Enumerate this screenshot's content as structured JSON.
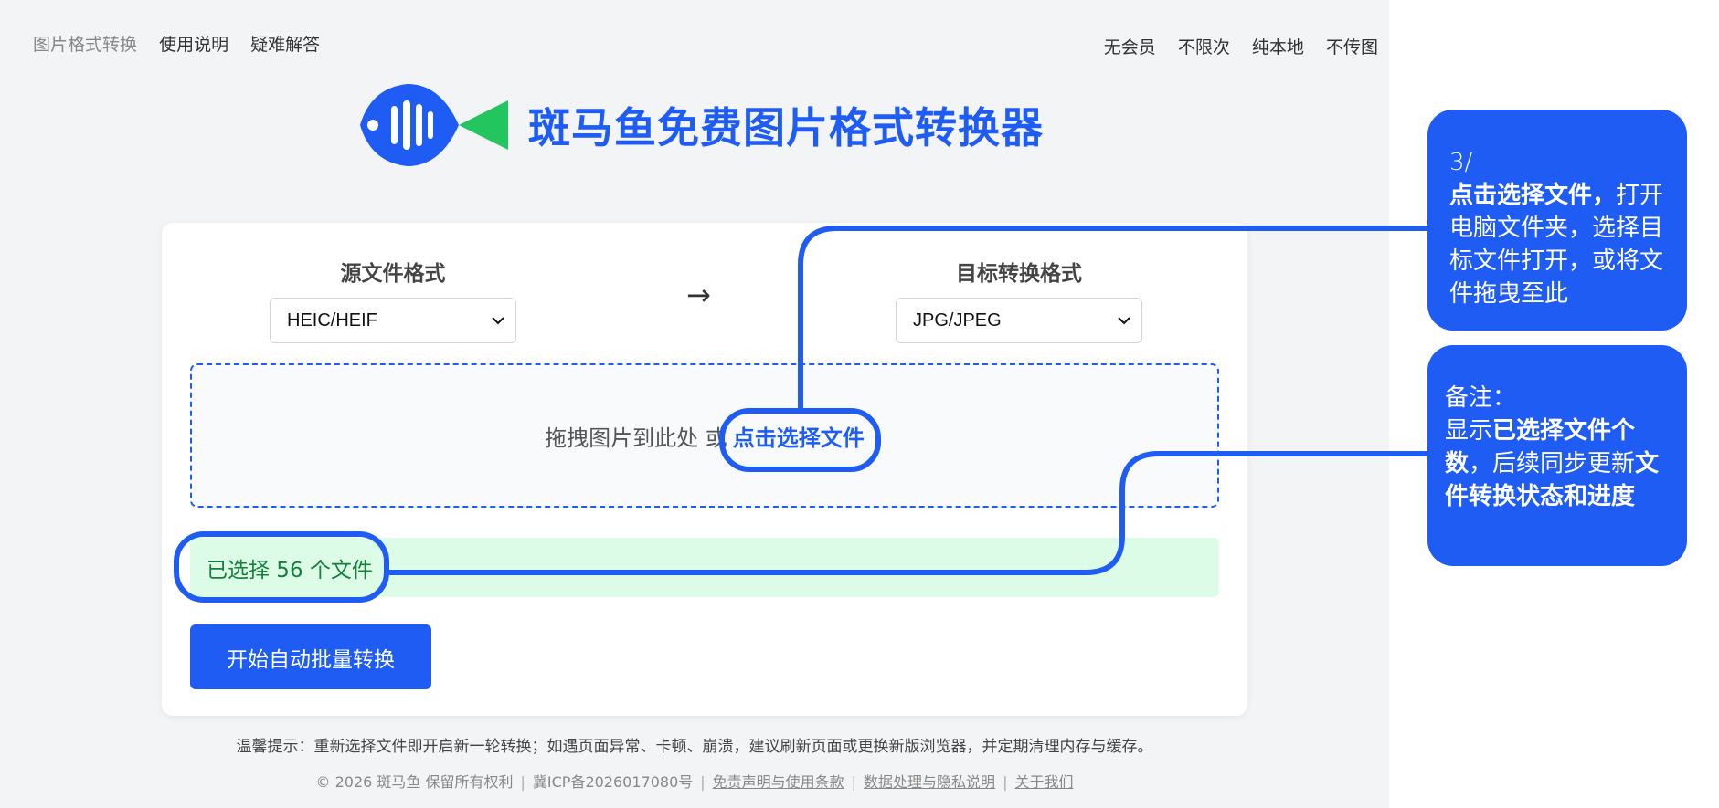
{
  "nav": {
    "left": [
      "图片格式转换",
      "使用说明",
      "疑难解答"
    ],
    "right": [
      "无会员",
      "不限次",
      "纯本地",
      "不传图"
    ]
  },
  "header": {
    "title": "斑马鱼免费图片格式转换器"
  },
  "converter": {
    "source_label": "源文件格式",
    "source_value": "HEIC/HEIF",
    "arrow": "→",
    "target_label": "目标转换格式",
    "target_value": "JPG/JPEG"
  },
  "dropzone": {
    "text": "拖拽图片到此处 或",
    "link": "点击选择文件"
  },
  "status": {
    "text": "已选择 56 个文件"
  },
  "start_button": "开始自动批量转换",
  "tip": "温馨提示：重新选择文件即开启新一轮转换；如遇页面异常、卡顿、崩溃，建议刷新页面或更换新版浏览器，并定期清理内存与缓存。",
  "footer": {
    "copyright": "© 2026 斑马鱼 保留所有权利",
    "icp": "冀ICP备2026017080号",
    "links": [
      "免责声明与使用条款",
      "数据处理与隐私说明",
      "关于我们"
    ]
  },
  "callouts": {
    "step": {
      "number": "3/",
      "bold": "点击选择文件，",
      "text": "打开电脑文件夹，选择目标文件打开，或将文件拖曳至此"
    },
    "note": {
      "title": "备注：",
      "p1": "显示",
      "b1": "已选择文件个数",
      "p2": "，后续同步更新",
      "b2": "文件转换状态和进度"
    }
  },
  "colors": {
    "accent": "#1f5cf4",
    "success_bg": "#dcfce7",
    "success_text": "#15803d",
    "logo_green": "#22c55e"
  }
}
